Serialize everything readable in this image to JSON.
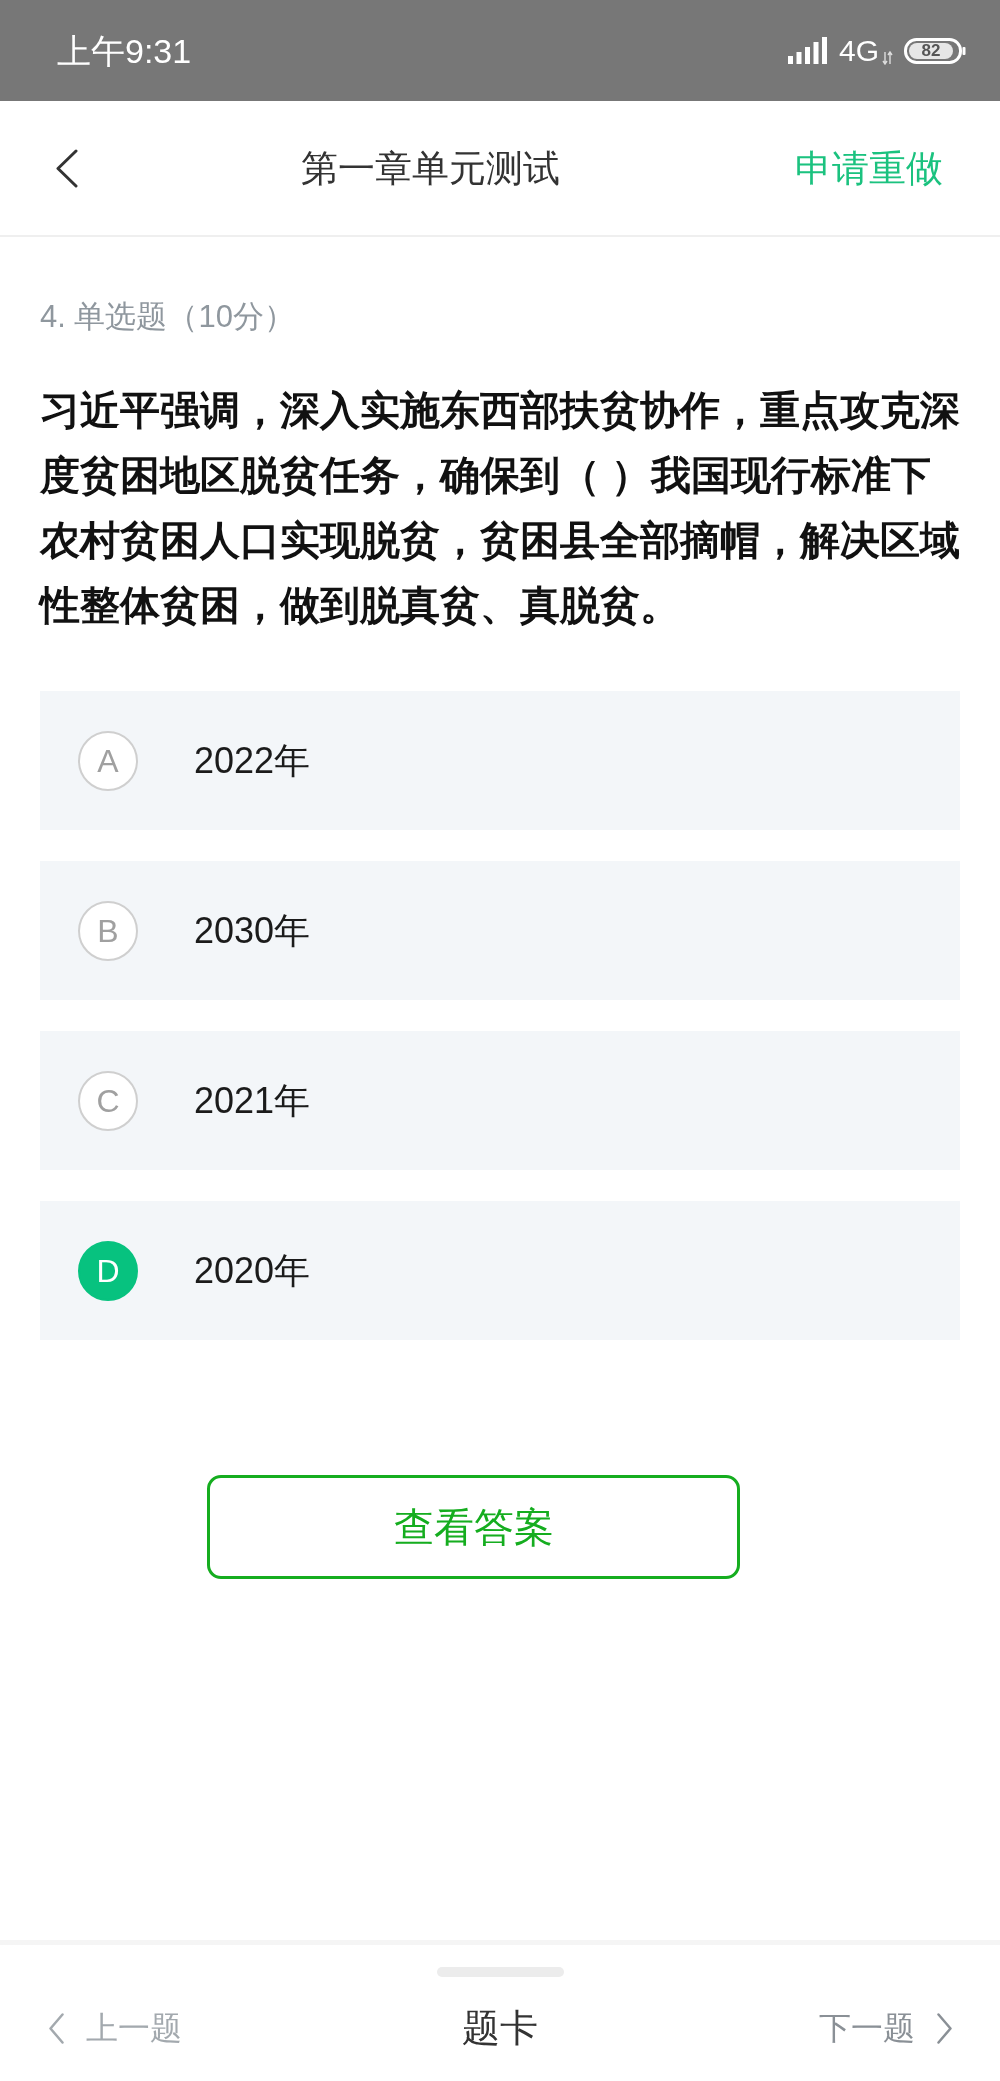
{
  "status_bar": {
    "time": "上午9:31",
    "network": "4G",
    "battery": "82"
  },
  "header": {
    "title": "第一章单元测试",
    "action": "申请重做"
  },
  "question": {
    "meta": "4. 单选题（10分）",
    "text": "习近平强调，深入实施东西部扶贫协作，重点攻克深度贫困地区脱贫任务，确保到（ ）我国现行标准下农村贫困人口实现脱贫，贫困县全部摘帽，解决区域性整体贫困，做到脱真贫、真脱贫。",
    "options": [
      {
        "letter": "A",
        "text": "2022年",
        "selected": false
      },
      {
        "letter": "B",
        "text": "2030年",
        "selected": false
      },
      {
        "letter": "C",
        "text": "2021年",
        "selected": false
      },
      {
        "letter": "D",
        "text": "2020年",
        "selected": true
      }
    ]
  },
  "answer_button": "查看答案",
  "bottom_bar": {
    "previous": "上一题",
    "card": "题卡",
    "next": "下一题"
  }
}
